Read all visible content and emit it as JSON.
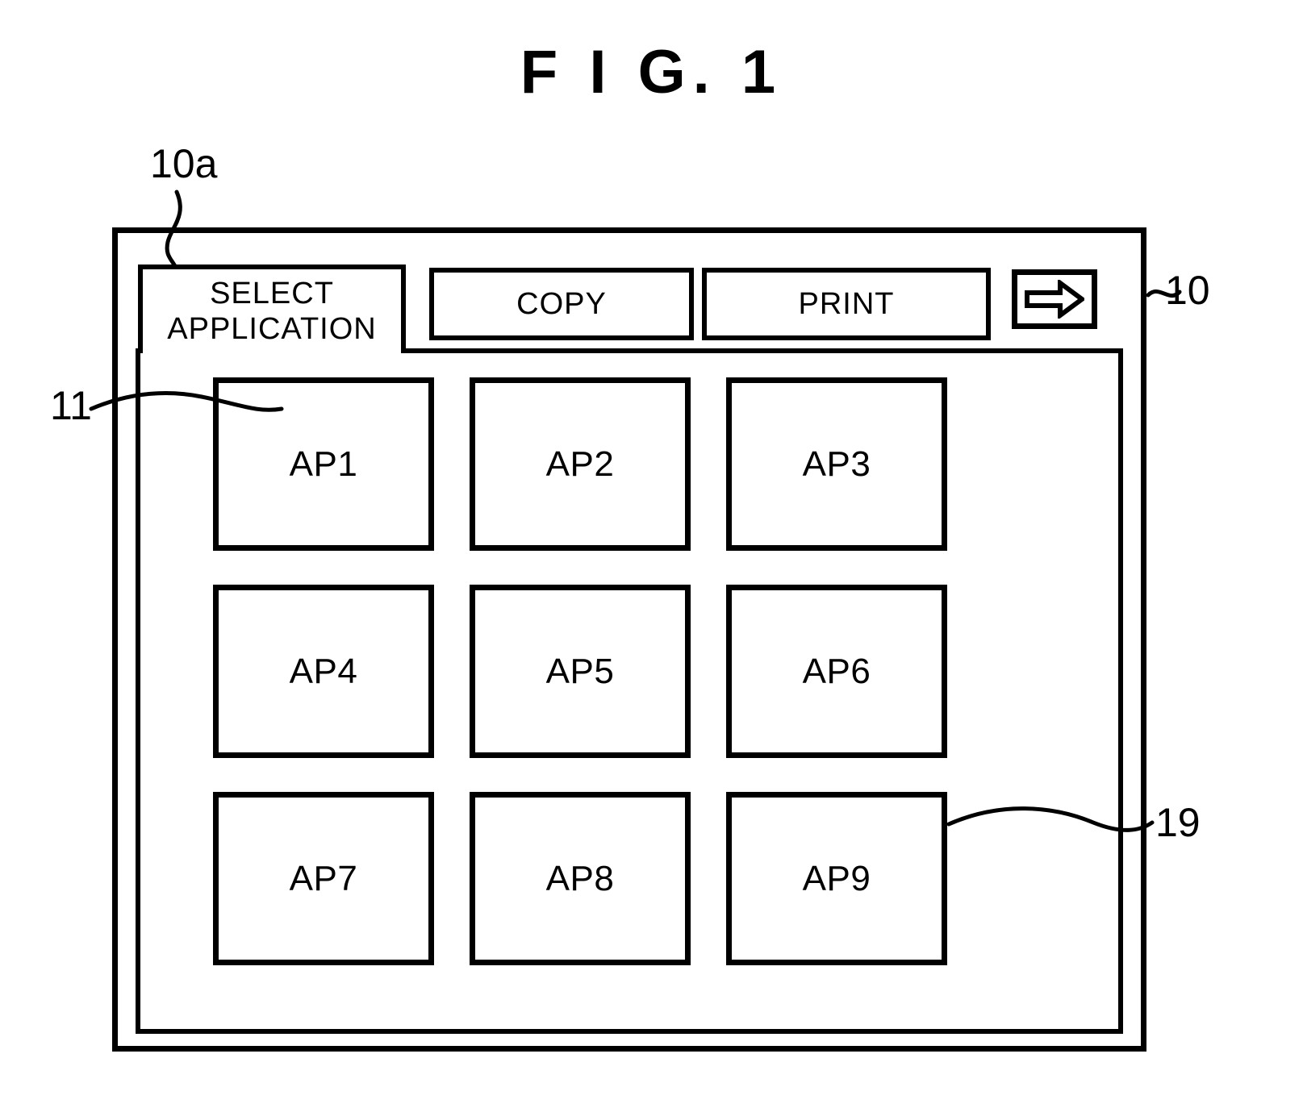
{
  "figure": {
    "title": "F I G.  1"
  },
  "panel": {
    "tabs": [
      {
        "id": "select-application",
        "label_line1": "SELECT",
        "label_line2": "APPLICATION",
        "active": true
      },
      {
        "id": "copy",
        "label": "COPY",
        "active": false
      },
      {
        "id": "print",
        "label": "PRINT",
        "active": false
      }
    ],
    "next_button": {
      "icon": "right-arrow-icon"
    },
    "app_buttons": [
      {
        "label": "AP1"
      },
      {
        "label": "AP2"
      },
      {
        "label": "AP3"
      },
      {
        "label": "AP4"
      },
      {
        "label": "AP5"
      },
      {
        "label": "AP6"
      },
      {
        "label": "AP7"
      },
      {
        "label": "AP8"
      },
      {
        "label": "AP9"
      }
    ]
  },
  "reference_numerals": [
    {
      "id": "ref-10a",
      "label": "10a",
      "points_to": "inner-operation-panel"
    },
    {
      "id": "ref-10",
      "label": "10",
      "points_to": "outer-device-frame"
    },
    {
      "id": "ref-11",
      "label": "11",
      "points_to": "app-button-ap1"
    },
    {
      "id": "ref-19",
      "label": "19",
      "points_to": "app-button-ap9"
    }
  ],
  "colors": {
    "ink": "#000000",
    "paper": "#ffffff"
  }
}
